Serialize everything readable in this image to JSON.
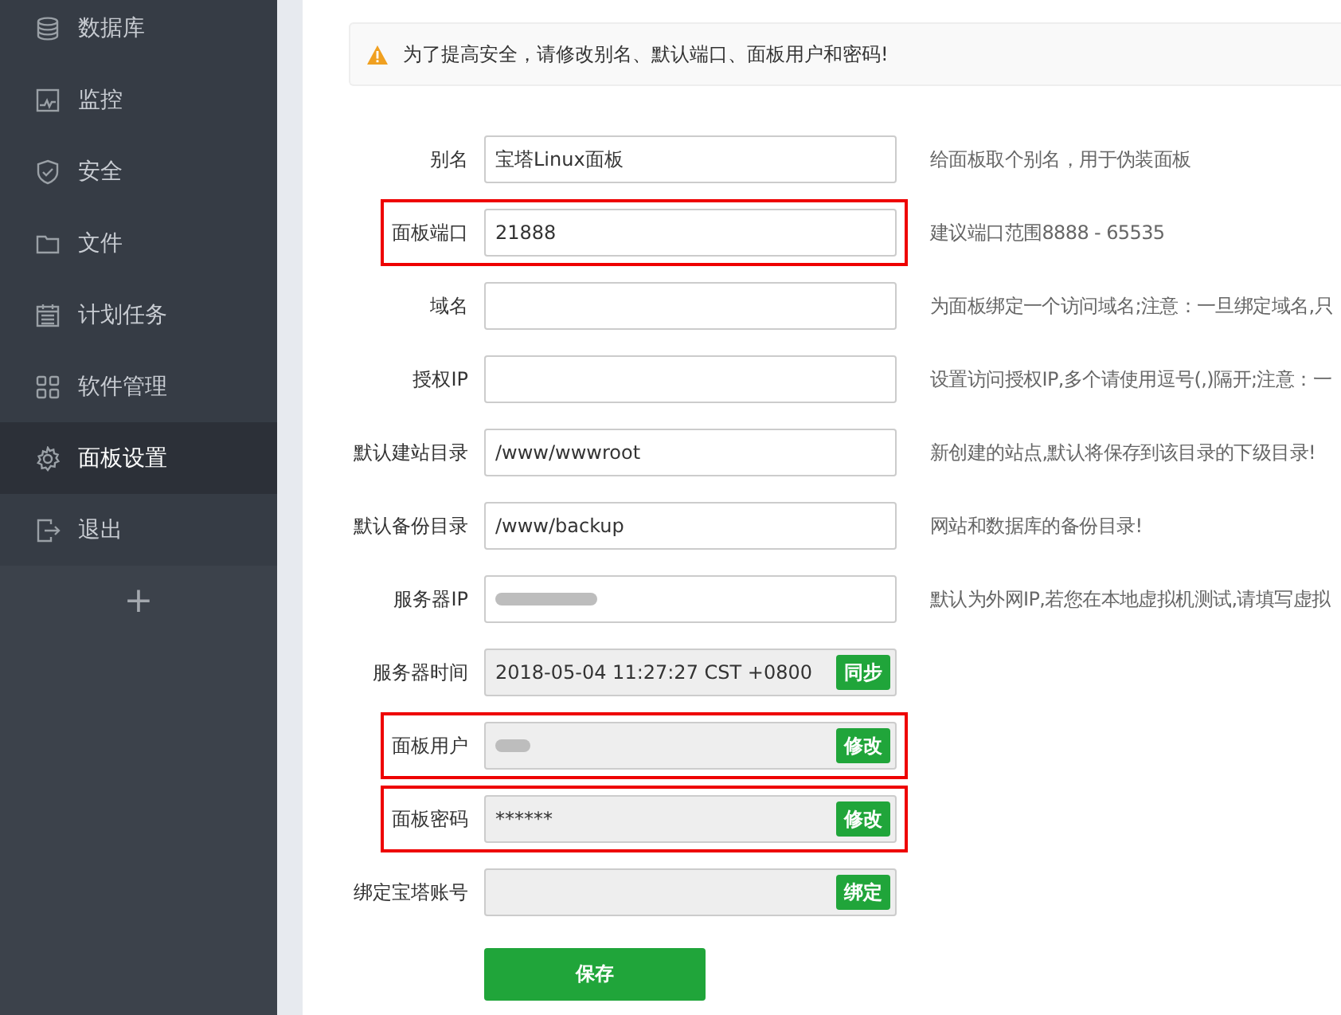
{
  "sidebar": {
    "items": [
      {
        "label": "数据库",
        "selected": false
      },
      {
        "label": "监控",
        "selected": false
      },
      {
        "label": "安全",
        "selected": false
      },
      {
        "label": "文件",
        "selected": false
      },
      {
        "label": "计划任务",
        "selected": false
      },
      {
        "label": "软件管理",
        "selected": false
      },
      {
        "label": "面板设置",
        "selected": true
      },
      {
        "label": "退出",
        "selected": false
      }
    ],
    "add_button": "+"
  },
  "alert": {
    "text": "为了提高安全，请修改别名、默认端口、面板用户和密码!"
  },
  "form": {
    "rows": [
      {
        "label": "别名",
        "kind": "text",
        "value": "宝塔Linux面板",
        "hint": "给面板取个别名，用于伪装面板",
        "highlighted": false
      },
      {
        "label": "面板端口",
        "kind": "text",
        "value": "21888",
        "hint": "建议端口范围8888 - 65535",
        "highlighted": true
      },
      {
        "label": "域名",
        "kind": "text",
        "hint": "为面板绑定一个访问域名;注意：一旦绑定域名,只",
        "highlighted": false
      },
      {
        "label": "授权IP",
        "kind": "text",
        "hint": "设置访问授权IP,多个请使用逗号(,)隔开;注意：一",
        "highlighted": false
      },
      {
        "label": "默认建站目录",
        "kind": "text",
        "value": "/www/wwwroot",
        "hint": "新创建的站点,默认将保存到该目录的下级目录!",
        "highlighted": false
      },
      {
        "label": "默认备份目录",
        "kind": "text",
        "value": "/www/backup",
        "hint": "网站和数据库的备份目录!",
        "highlighted": false
      },
      {
        "label": "服务器IP",
        "kind": "masked-text",
        "hint": "默认为外网IP,若您在本地虚拟机测试,请填写虚拟",
        "highlighted": false
      },
      {
        "label": "服务器时间",
        "kind": "action",
        "value": "2018-05-04 11:27:27 CST +0800",
        "action": "同步",
        "highlighted": false
      },
      {
        "label": "面板用户",
        "kind": "masked-action",
        "action": "修改",
        "highlighted": true
      },
      {
        "label": "面板密码",
        "kind": "action",
        "value": "******",
        "action": "修改",
        "highlighted": true
      },
      {
        "label": "绑定宝塔账号",
        "kind": "action",
        "action": "绑定",
        "highlighted": false
      }
    ],
    "save_button": "保存"
  }
}
